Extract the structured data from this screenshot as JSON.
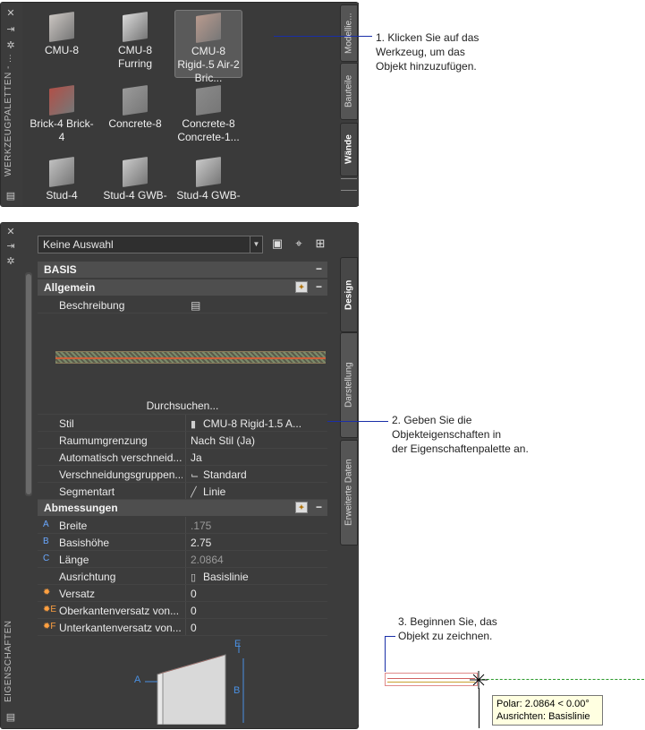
{
  "tool_palette": {
    "title": "WERKZEUGPALETTEN - ...",
    "tabs": [
      "Modellie...",
      "Bauteile",
      "Wände"
    ],
    "active_tab": "Wände",
    "tools": [
      {
        "label": "CMU-8",
        "color": "#c9c4c0"
      },
      {
        "label": "CMU-8 Furring",
        "color": "#d8d8d8"
      },
      {
        "label": "CMU-8 Rigid-.5 Air-2 Bric...",
        "color": "#b89a8e"
      },
      {
        "label": "Brick-4 Brick-4",
        "color": "#b05048"
      },
      {
        "label": "Concrete-8",
        "color": "#9a9a9a"
      },
      {
        "label": "Concrete-8 Concrete-1...",
        "color": "#8a8a8a"
      },
      {
        "label": "Stud-4",
        "color": "#c0c0c0"
      },
      {
        "label": "Stud-4 GWB-",
        "color": "#c8c8c8"
      },
      {
        "label": "Stud-4 GWB-",
        "color": "#c8c8c8"
      }
    ]
  },
  "properties": {
    "title": "EIGENSCHAFTEN",
    "selection": "Keine Auswahl",
    "tabs": [
      "Design",
      "Darstellung",
      "Erweiterte Daten"
    ],
    "active_tab": "Design",
    "section_basis": "BASIS",
    "group_allgemein": "Allgemein",
    "beschreibung_label": "Beschreibung",
    "browse": "Durchsuchen...",
    "allgemein_rows": [
      {
        "label": "Stil",
        "value": "CMU-8 Rigid-1.5 A...",
        "icon": "style-icon"
      },
      {
        "label": "Raumumgrenzung",
        "value": "Nach Stil (Ja)"
      },
      {
        "label": "Automatisch verschneid...",
        "value": "Ja"
      },
      {
        "label": "Verschneidungsgruppen...",
        "value": "Standard",
        "icon": "cleanup-icon"
      },
      {
        "label": "Segmentart",
        "value": "Linie",
        "icon": "line-icon"
      }
    ],
    "group_abmessungen": "Abmessungen",
    "abmessungen_rows": [
      {
        "marker": "A",
        "label": "Breite",
        "value": ".175",
        "dim": true
      },
      {
        "marker": "B",
        "label": "Basishöhe",
        "value": "2.75",
        "dim": false
      },
      {
        "marker": "C",
        "label": "Länge",
        "value": "2.0864",
        "dim": true
      },
      {
        "marker": "",
        "label": "Ausrichtung",
        "value": "Basislinie",
        "icon": "justify-icon"
      },
      {
        "marker": "✹",
        "label": "Versatz",
        "value": "0",
        "orange": true
      },
      {
        "marker": "✹E",
        "label": "Oberkantenversatz von...",
        "value": "0",
        "orange": true
      },
      {
        "marker": "✹F",
        "label": "Unterkantenversatz von...",
        "value": "0",
        "orange": true
      }
    ],
    "diagram_labels": {
      "a": "A",
      "b": "B",
      "e": "E"
    }
  },
  "annotations": {
    "step1": "1. Klicken Sie auf das\nWerkzeug, um das\nObjekt hinzuzufügen.",
    "step2": "2. Geben Sie die\nObjekteigenschaften in\nder Eigenschaftenpalette an.",
    "step3": "3. Beginnen Sie, das\nObjekt zu zeichnen."
  },
  "tooltip": {
    "line1": "Polar: 2.0864 < 0.00°",
    "line2": "Ausrichten: Basislinie"
  },
  "colors": {
    "leader": "#1a2fa8",
    "panel": "#3c3c3c",
    "tooltip_bg": "#ffffe1"
  }
}
